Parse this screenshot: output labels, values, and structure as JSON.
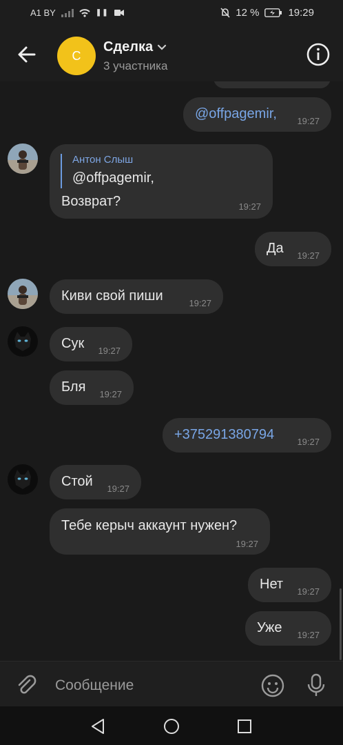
{
  "status_bar": {
    "carrier": "A1 BY",
    "battery": "12 %",
    "time": "19:29"
  },
  "header": {
    "avatar_letter": "С",
    "title": "Сделка",
    "subtitle": "3 участника"
  },
  "messages": [
    {
      "text": "@offpagemir,",
      "time": "19:27"
    },
    {
      "quote_author": "Антон Слыш",
      "quote_text": "@offpagemir,",
      "text": "Возврат?",
      "time": "19:27"
    },
    {
      "text": "Да",
      "time": "19:27"
    },
    {
      "text": "Киви свой пиши",
      "time": "19:27"
    },
    {
      "text": "Сук",
      "time": "19:27"
    },
    {
      "text": "Бля",
      "time": "19:27"
    },
    {
      "text": "+375291380794",
      "time": "19:27"
    },
    {
      "text": "Стой",
      "time": "19:27"
    },
    {
      "text": "Тебе керыч аккаунт нужен?",
      "time": "19:27"
    },
    {
      "text": "Нет",
      "time": "19:27"
    },
    {
      "text": "Уже",
      "time": "19:27"
    }
  ],
  "composer": {
    "placeholder": "Сообщение"
  },
  "icons": {
    "back": "arrow-left-icon",
    "info": "info-icon",
    "attach": "paperclip-icon",
    "emoji": "emoji-icon",
    "mic": "microphone-icon",
    "nav_back": "triangle-back-icon",
    "nav_home": "circle-home-icon",
    "nav_recent": "square-recent-icon"
  },
  "colors": {
    "background": "#1a1a1a",
    "bubble": "#2f2f2f",
    "avatar": "#f2c21a",
    "link": "#79a6e6"
  }
}
